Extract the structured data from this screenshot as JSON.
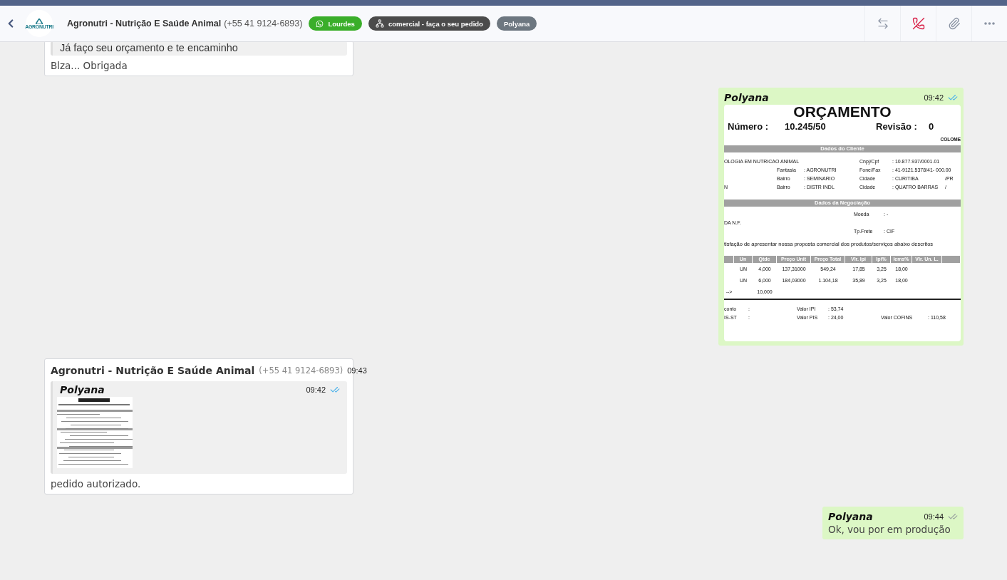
{
  "header": {
    "logo_text": "AGRONUTRI",
    "contact_name": "Agronutri - Nutrição E Saúde Animal",
    "contact_phone": "(+55 41 9124-6893)",
    "tags": [
      {
        "kind": "whatsapp",
        "label": "Lourdes",
        "color": "#3aae2a"
      },
      {
        "kind": "department",
        "label": "comercial - faça o seu pedido",
        "color": "#4b4b4b"
      },
      {
        "kind": "agent",
        "label": "Polyana",
        "color": "#6d7780"
      }
    ]
  },
  "messages": [
    {
      "kind": "incoming",
      "quote": {
        "text": "Já faço seu orçamento e te encaminho"
      },
      "text": "Blza... Obrigada"
    },
    {
      "kind": "outgoing_image",
      "sender": "Polyana",
      "time": "09:42",
      "read": true,
      "document": {
        "title": "ORÇAMENTO",
        "number_label": "Número :",
        "number": "10.245/50",
        "revision_label": "Revisão :",
        "revision": "0",
        "company": "COLOME",
        "client_header": "Dados do Cliente",
        "client_rows": [
          {
            "name": "OLOGIA EM NUTRICAO ANIMAL",
            "label_b": "Cnpj/Cpf",
            "value_b": ": 10.877.937/0001.01"
          },
          {
            "label_a": "Fantasia",
            "value_a": ": AGRONUTRI",
            "label_b": "Fone/Fax",
            "value_b": ": 41-9121.5378/41- 000.00"
          },
          {
            "label_a": "Bairro",
            "value_a": ": SEMINARIO",
            "label_b": "Cidade",
            "value_b": ": CURITIBA",
            "extra": "/PR"
          },
          {
            "name": "N",
            "label_a": "Bairro",
            "value_a": ": DISTR INDL",
            "label_b": "Cidade",
            "value_b": ": QUATRO BARRAS",
            "extra": "/"
          }
        ],
        "negotiation_header": "Dados da Negociação",
        "negotiation_rows": [
          {
            "label": "Moeda",
            "value": ": -"
          },
          {
            "left": "DA N.F."
          },
          {
            "label": "Tp.Frete",
            "value": ": CIF"
          }
        ],
        "intro": "tisfação de apresentar nossa proposta comercial dos produtos/serviços abaixo descritos",
        "table_columns": [
          "",
          "Un",
          "Qtde",
          "Preço Unit",
          "Preço Total",
          "Vlr. Ipi",
          "Ipi%",
          "Icms%",
          "Vlr. Un. L.",
          ""
        ],
        "table_rows": [
          [
            "",
            "UN",
            "4,000",
            "137,31000",
            "549,24",
            "17,85",
            "3,25",
            "18,00",
            "",
            ""
          ],
          [
            "",
            "UN",
            "6,000",
            "184,03000",
            "1.104,18",
            "35,89",
            "3,25",
            "18,00",
            "",
            ""
          ],
          [
            "-->",
            "",
            "10,000",
            "",
            "",
            "",
            "",
            "",
            "",
            ""
          ]
        ],
        "totals": [
          [
            "conto",
            ":",
            "Valor IPI",
            ": 53,74"
          ],
          [
            "IS-ST",
            ":",
            "Valor PIS",
            ": 24,00",
            "Valor COFINS",
            ": 110,58"
          ]
        ]
      }
    },
    {
      "kind": "incoming_forward",
      "sender": "Agronutri - Nutrição E Saúde Animal",
      "phone": "(+55 41 9124-6893)",
      "time": "09:43",
      "quote": {
        "sender": "Polyana",
        "time": "09:42",
        "read": true
      },
      "text": "pedido autorizado."
    },
    {
      "kind": "outgoing",
      "sender": "Polyana",
      "time": "09:44",
      "read": false,
      "text": "Ok, vou por em produção"
    }
  ]
}
